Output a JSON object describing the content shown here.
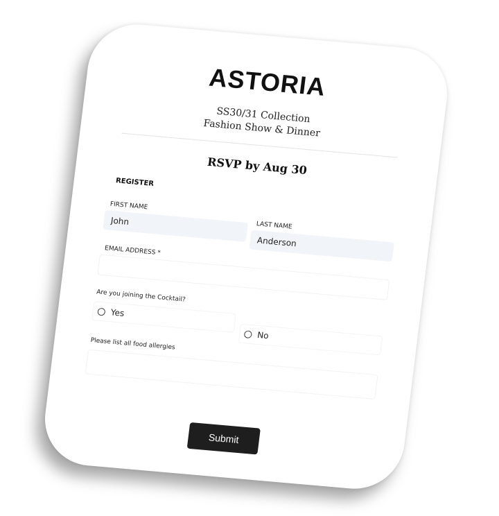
{
  "brand": {
    "logo_text": "ASTORIA"
  },
  "event": {
    "collection_line": "SS30/31 Collection",
    "event_line": "Fashion Show & Dinner",
    "rsvp_deadline": "RSVP by Aug 30"
  },
  "form": {
    "section_title": "REGISTER",
    "first_name": {
      "label": "FIRST NAME",
      "value": "John"
    },
    "last_name": {
      "label": "LAST NAME",
      "value": "Anderson"
    },
    "email": {
      "label": "EMAIL ADDRESS *",
      "value": ""
    },
    "cocktail": {
      "question": "Are you joining the Cocktail?",
      "options": [
        {
          "label": "Yes",
          "selected": false
        },
        {
          "label": "No",
          "selected": false
        }
      ]
    },
    "allergies": {
      "label": "Please list all food allergies",
      "value": ""
    },
    "submit_label": "Submit"
  }
}
